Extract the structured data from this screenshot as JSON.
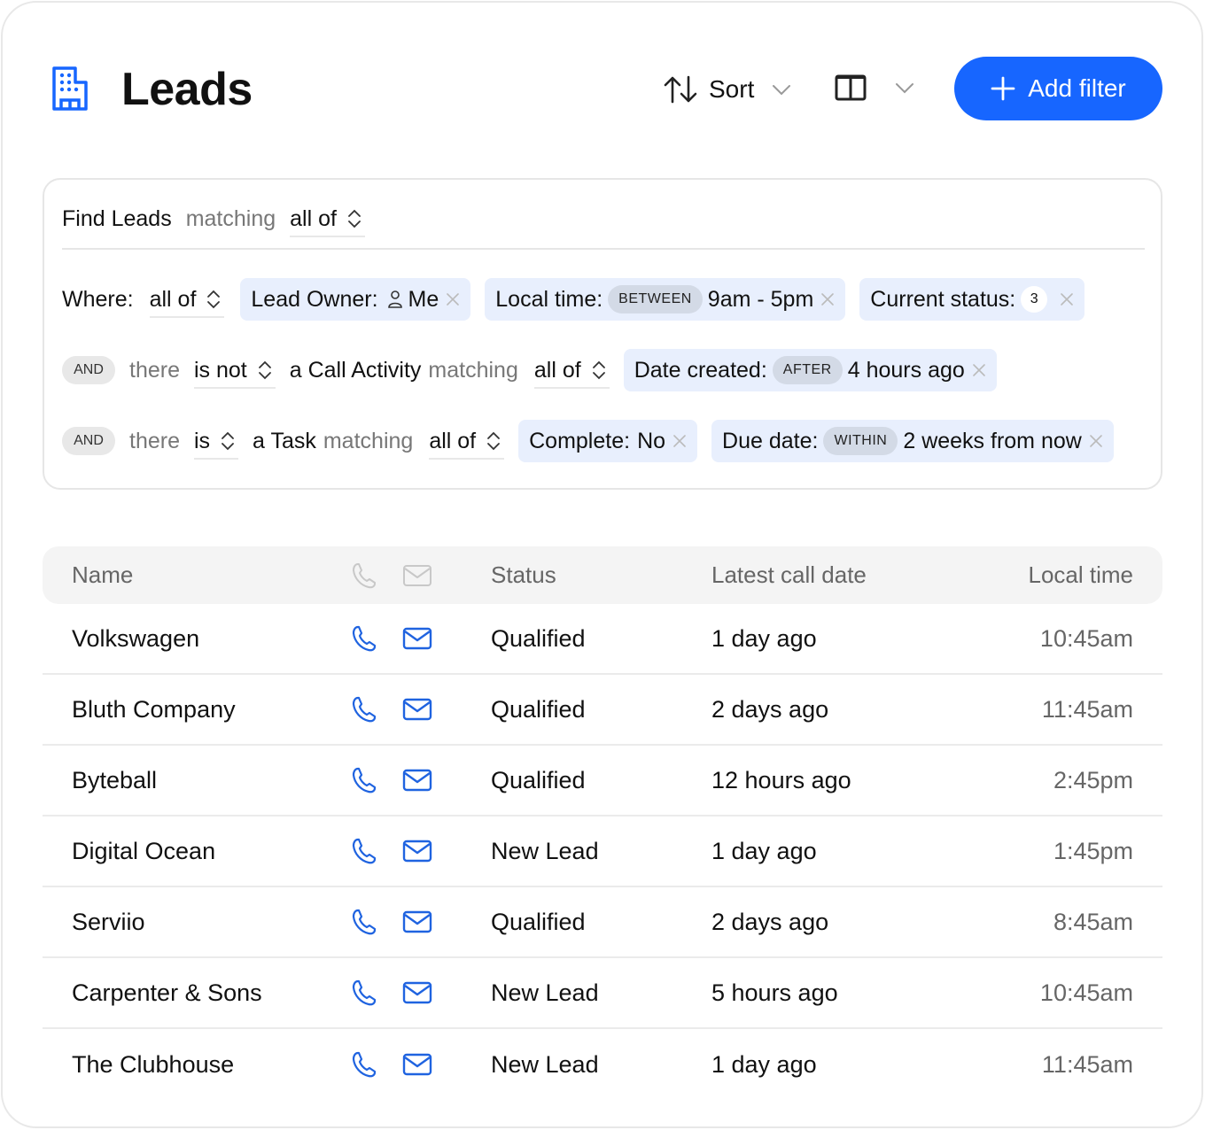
{
  "header": {
    "title": "Leads",
    "logo_icon": "building-icon",
    "sort_label": "Sort",
    "add_filter_label": "Add filter",
    "accent_color": "#1766ff"
  },
  "filters": {
    "find_label": "Find Leads",
    "matching_label": "matching",
    "root_match": "all of",
    "where_label": "Where:",
    "where_match": "all of",
    "where_chips": [
      {
        "field": "Lead Owner:",
        "icon": "person-icon",
        "value": "Me"
      },
      {
        "field": "Local time:",
        "operator": "BETWEEN",
        "value": "9am - 5pm"
      },
      {
        "field": "Current status:",
        "count": "3"
      }
    ],
    "groups": [
      {
        "conjunction": "AND",
        "there_label": "there",
        "existence": "is not",
        "object": "a Call Activity",
        "matching_label": "matching",
        "match": "all of",
        "chips": [
          {
            "field": "Date created:",
            "operator": "AFTER",
            "value": "4 hours ago"
          }
        ]
      },
      {
        "conjunction": "AND",
        "there_label": "there",
        "existence": "is",
        "object": "a Task",
        "matching_label": "matching",
        "match": "all of",
        "chips": [
          {
            "field": "Complete:",
            "value": "No"
          },
          {
            "field": "Due date:",
            "operator": "WITHIN",
            "value": "2 weeks from now"
          }
        ]
      }
    ]
  },
  "table": {
    "columns": {
      "name": "Name",
      "phone_icon": "phone-icon",
      "mail_icon": "mail-icon",
      "status": "Status",
      "latest_call": "Latest call date",
      "local_time": "Local time"
    },
    "rows": [
      {
        "name": "Volkswagen",
        "status": "Qualified",
        "latest_call": "1 day ago",
        "local_time": "10:45am"
      },
      {
        "name": "Bluth Company",
        "status": "Qualified",
        "latest_call": "2 days ago",
        "local_time": "11:45am"
      },
      {
        "name": "Byteball",
        "status": "Qualified",
        "latest_call": "12 hours ago",
        "local_time": "2:45pm"
      },
      {
        "name": "Digital Ocean",
        "status": "New Lead",
        "latest_call": "1 day ago",
        "local_time": "1:45pm"
      },
      {
        "name": "Serviio",
        "status": "Qualified",
        "latest_call": "2 days ago",
        "local_time": "8:45am"
      },
      {
        "name": "Carpenter & Sons",
        "status": "New Lead",
        "latest_call": "5 hours ago",
        "local_time": "10:45am"
      },
      {
        "name": "The Clubhouse",
        "status": "New Lead",
        "latest_call": "1 day ago",
        "local_time": "11:45am"
      }
    ]
  }
}
